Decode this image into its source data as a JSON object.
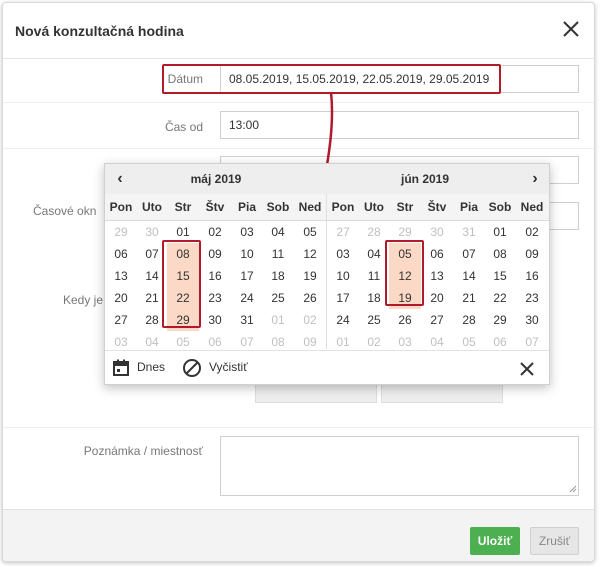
{
  "dialog": {
    "title": "Nová konzultačná hodina",
    "close_icon": "close-icon"
  },
  "form": {
    "date_label": "Dátum",
    "date_value": "08.05.2019, 15.05.2019, 22.05.2019, 29.05.2019",
    "time_from_label": "Čas od",
    "time_from_value": "13:00",
    "time_window_label": "Časové okn",
    "when_label": "Kedy je",
    "note_label": "Poznámka / miestnosť",
    "note_value": ""
  },
  "calendar": {
    "prev_icon": "chevron-left-icon",
    "next_icon": "chevron-right-icon",
    "prev_label": "‹",
    "next_label": "›",
    "left_month": "máj 2019",
    "right_month": "jún 2019",
    "weekdays": [
      "Pon",
      "Uto",
      "Str",
      "Štv",
      "Pia",
      "Sob",
      "Ned"
    ],
    "left_weeks": [
      [
        "29",
        "30",
        "01",
        "02",
        "03",
        "04",
        "05"
      ],
      [
        "06",
        "07",
        "08",
        "09",
        "10",
        "11",
        "12"
      ],
      [
        "13",
        "14",
        "15",
        "16",
        "17",
        "18",
        "19"
      ],
      [
        "20",
        "21",
        "22",
        "23",
        "24",
        "25",
        "26"
      ],
      [
        "27",
        "28",
        "29",
        "30",
        "31",
        "01",
        "02"
      ],
      [
        "03",
        "04",
        "05",
        "06",
        "07",
        "08",
        "09"
      ]
    ],
    "left_other": [
      [
        0,
        0
      ],
      [
        0,
        1
      ],
      [
        4,
        5
      ],
      [
        4,
        6
      ],
      [
        5,
        0
      ],
      [
        5,
        1
      ],
      [
        5,
        2
      ],
      [
        5,
        3
      ],
      [
        5,
        4
      ],
      [
        5,
        5
      ],
      [
        5,
        6
      ]
    ],
    "left_selected": [
      [
        1,
        2
      ],
      [
        2,
        2
      ],
      [
        3,
        2
      ],
      [
        4,
        2
      ]
    ],
    "right_weeks": [
      [
        "27",
        "28",
        "29",
        "30",
        "31",
        "01",
        "02"
      ],
      [
        "03",
        "04",
        "05",
        "06",
        "07",
        "08",
        "09"
      ],
      [
        "10",
        "11",
        "12",
        "13",
        "14",
        "15",
        "16"
      ],
      [
        "17",
        "18",
        "19",
        "20",
        "21",
        "22",
        "23"
      ],
      [
        "24",
        "25",
        "26",
        "27",
        "28",
        "29",
        "30"
      ],
      [
        "01",
        "02",
        "03",
        "04",
        "05",
        "06",
        "07"
      ]
    ],
    "right_other": [
      [
        0,
        0
      ],
      [
        0,
        1
      ],
      [
        0,
        2
      ],
      [
        0,
        3
      ],
      [
        0,
        4
      ],
      [
        5,
        0
      ],
      [
        5,
        1
      ],
      [
        5,
        2
      ],
      [
        5,
        3
      ],
      [
        5,
        4
      ],
      [
        5,
        5
      ],
      [
        5,
        6
      ]
    ],
    "right_selected": [
      [
        1,
        2
      ],
      [
        2,
        2
      ],
      [
        3,
        2
      ]
    ],
    "today_label": "Dnes",
    "today_icon": "calendar-icon",
    "clear_label": "Vyčistiť",
    "clear_icon": "clear-icon",
    "close_icon": "close-icon"
  },
  "footer": {
    "save_label": "Uložiť",
    "cancel_label": "Zrušiť"
  },
  "colors": {
    "highlight": "#b11a2b",
    "selected_day_bg": "#fbd9c6",
    "save_bg": "#4caf50"
  }
}
